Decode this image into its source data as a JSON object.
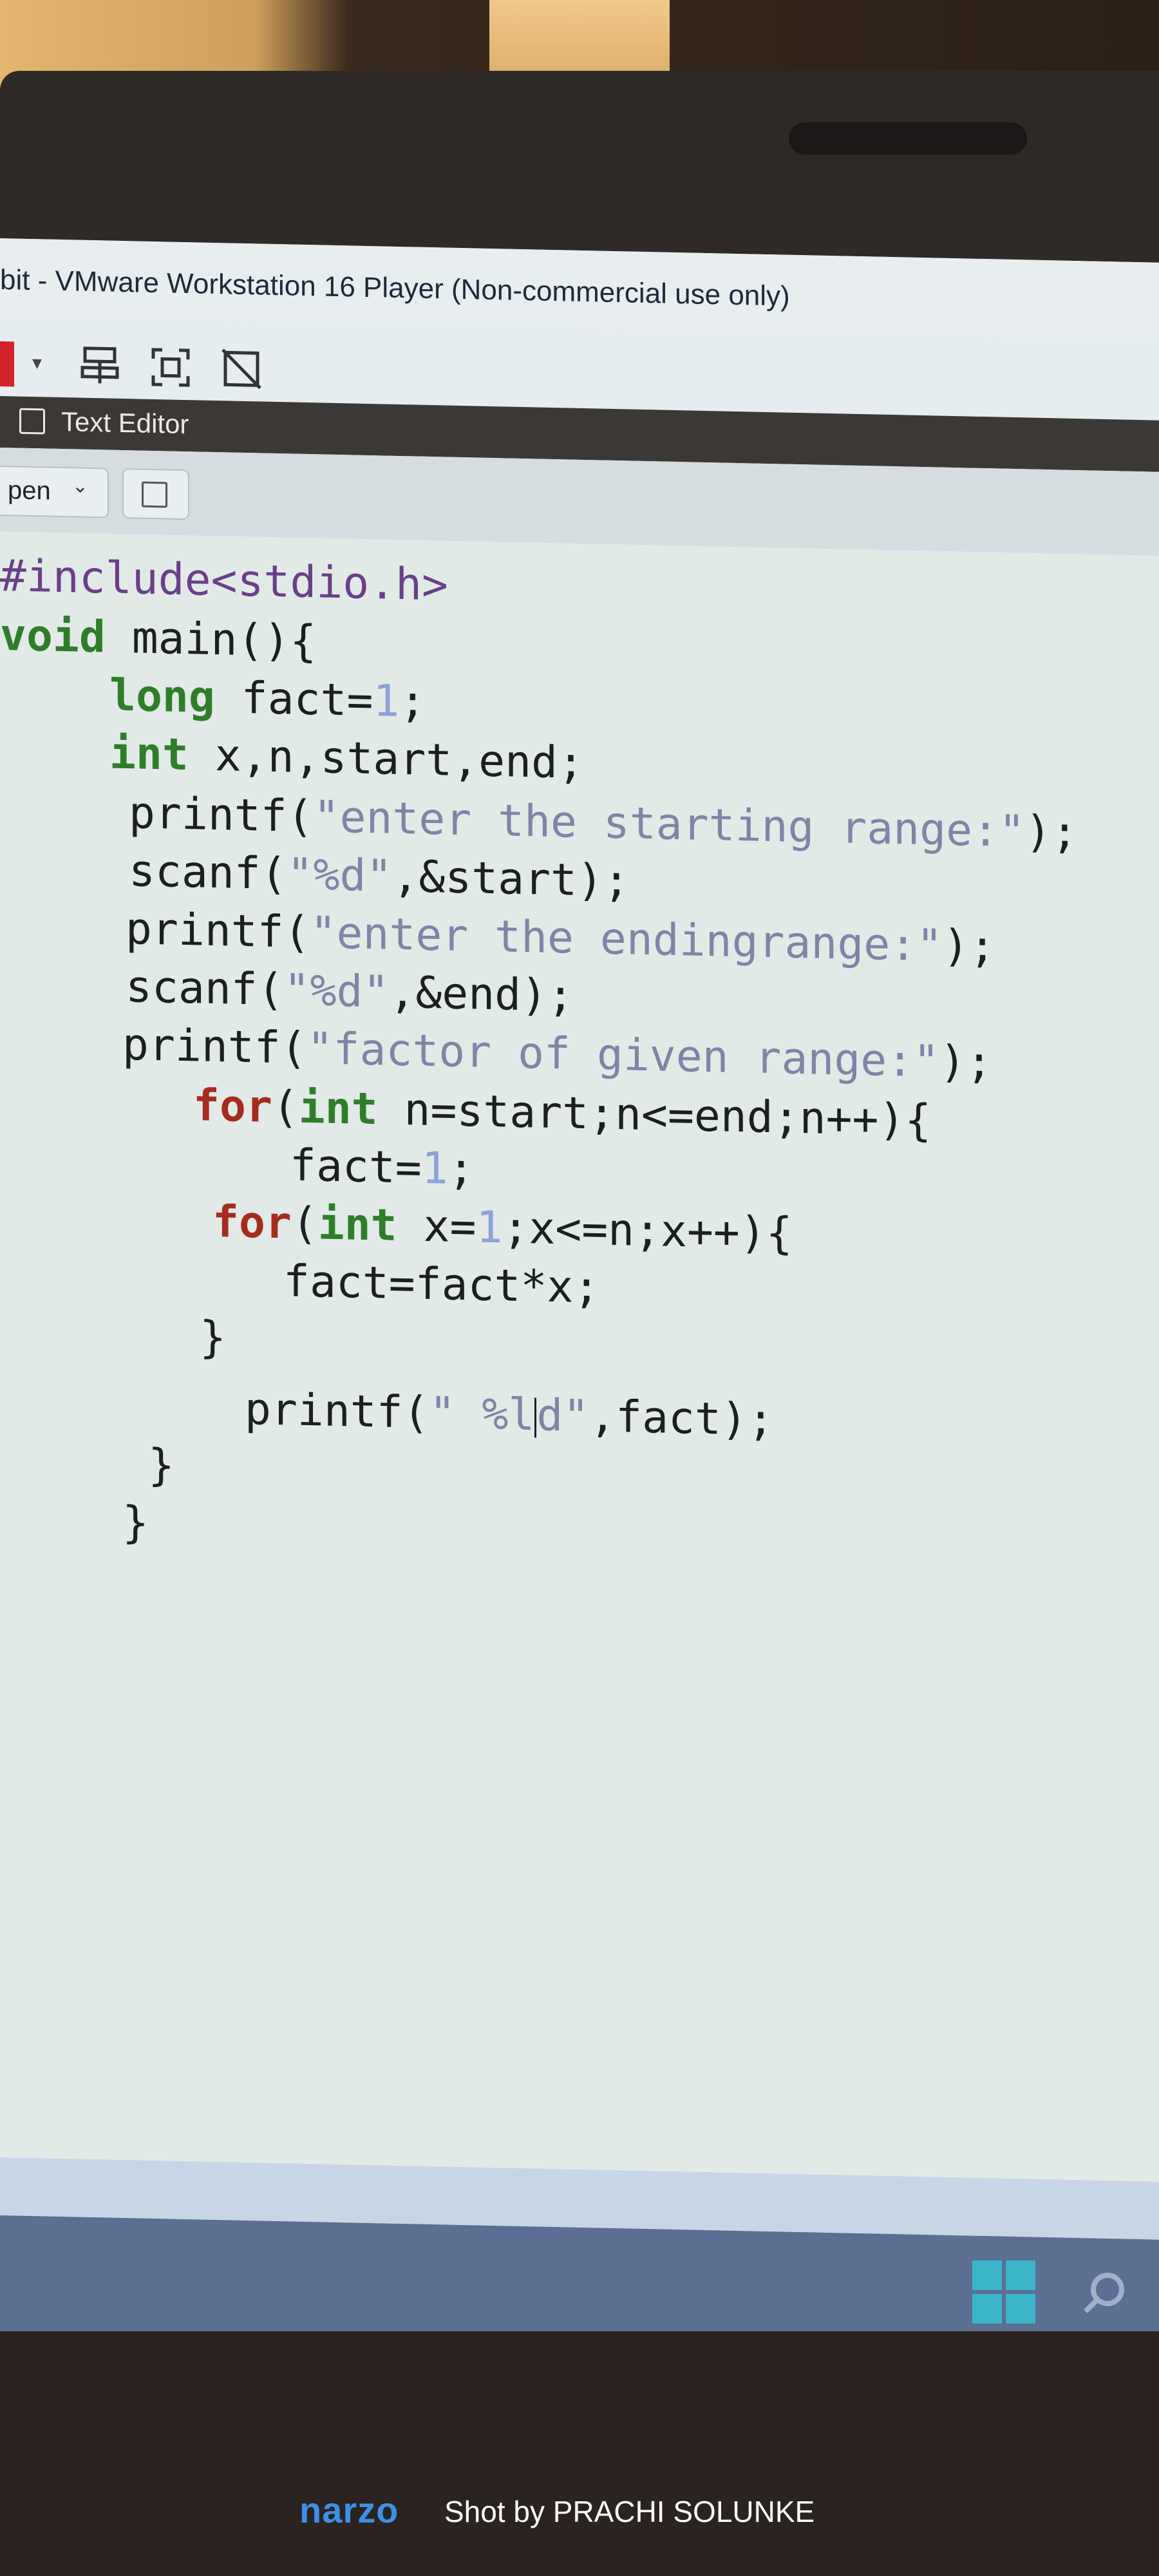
{
  "window": {
    "title": "bit - VMware Workstation 16 Player (Non-commercial use only)"
  },
  "toolbar": {
    "icons": [
      "power-icon",
      "dropdown-arrow-icon",
      "network-icon",
      "fullscreen-icon",
      "unity-icon"
    ]
  },
  "app": {
    "name": "Text Editor"
  },
  "header": {
    "open_label": "pen",
    "new_tab_icon": "new-tab-icon"
  },
  "code": {
    "lines": [
      "#include<stdio.h>",
      "void main(){",
      "    long fact=1;",
      "    int x,n,start,end;",
      "    printf(\"enter the starting range:\");",
      "    scanf(\"%d\",&start);",
      "    printf(\"enter the endingrange:\");",
      "    scanf(\"%d\",&end);",
      "    printf(\"factor of given range:\");",
      "      for(int n=start;n<=end;n++){",
      "        fact=1;",
      "      for(int x=1;x<=n;x++){",
      "        fact=fact*x;",
      "      }",
      "        printf(\" %ld\",fact);",
      "    }",
      "  }"
    ]
  },
  "watermark": {
    "brand": "narzo",
    "credit": "Shot by PRACHI SOLUNKE"
  },
  "colors": {
    "keyword": "#2f7d2a",
    "control_keyword": "#a52b1f",
    "string": "#7d86a6",
    "number": "#8ba2d8",
    "preprocessor": "#6a3f8a",
    "brand_blue": "#3d8fe8"
  }
}
